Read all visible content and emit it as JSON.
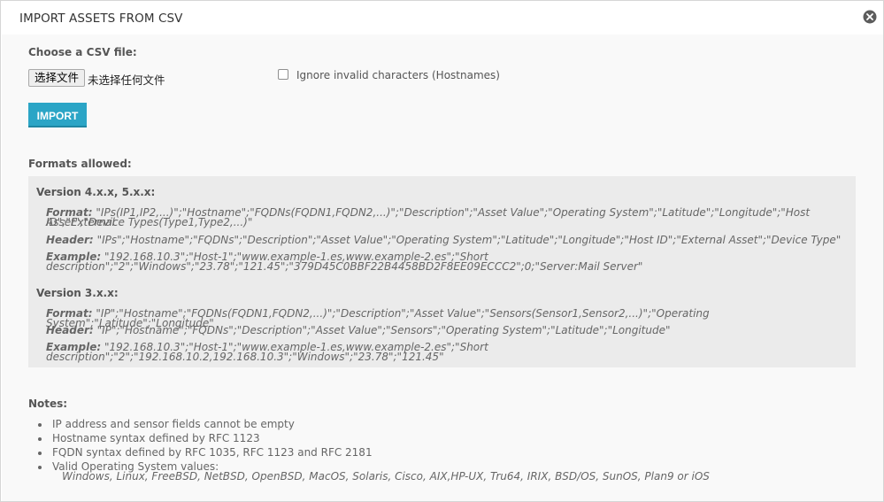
{
  "dialog": {
    "title": "IMPORT ASSETS FROM CSV",
    "choose_label": "Choose a CSV file:",
    "file_button": "选择文件",
    "file_status": "未选择任何文件",
    "ignore_label": "Ignore invalid characters (Hostnames)",
    "import_button": "IMPORT",
    "close_icon": "close-circle-icon"
  },
  "formats": {
    "label": "Formats allowed:",
    "v4": {
      "heading": "Version 4.x.x, 5.x.x:",
      "format_key": "Format:",
      "format_value_1": "\"IPs(IP1,IP2,...)\";\"Hostname\";\"FQDNs(FQDN1,FQDN2,...)\";\"Description\";\"Asset Value\";\"Operating System\";\"Latitude\";\"Longitude\";\"Host ID\";\"External",
      "format_value_2": "Asset\";\"Device Types(Type1,Type2,...)\"",
      "header_key": "Header:",
      "header_value": "\"IPs\";\"Hostname\";\"FQDNs\";\"Description\";\"Asset Value\";\"Operating System\";\"Latitude\";\"Longitude\";\"Host ID\";\"External Asset\";\"Device Type\"",
      "example_key": "Example:",
      "example_value_1": "\"192.168.10.3\";\"Host-1\";\"www.example-1.es,www.example-2.es\";\"Short",
      "example_value_2": "description\";\"2\";\"Windows\";\"23.78\";\"121.45\";\"379D45C0BBF22B4458BD2F8EE09ECCC2\";0;\"Server:Mail Server\""
    },
    "v3": {
      "heading": "Version 3.x.x:",
      "format_key": "Format:",
      "format_value": "\"IP\";\"Hostname\";\"FQDNs(FQDN1,FQDN2,...)\";\"Description\";\"Asset Value\";\"Sensors(Sensor1,Sensor2,...)\";\"Operating System\";\"Latitude\";\"Longitude\"",
      "header_key": "Header:",
      "header_value": "\"IP\";\"Hostname\";\"FQDNs\";\"Description\";\"Asset Value\";\"Sensors\";\"Operating System\";\"Latitude\";\"Longitude\"",
      "example_key": "Example:",
      "example_value": "\"192.168.10.3\";\"Host-1\";\"www.example-1.es,www.example-2.es\";\"Short description\";\"2\";\"192.168.10.2,192.168.10.3\";\"Windows\";\"23.78\";\"121.45\""
    }
  },
  "notes": {
    "label": "Notes:",
    "items": [
      "IP address and sensor fields cannot be empty",
      "Hostname syntax defined by RFC 1123",
      "FQDN syntax defined by RFC 1035, RFC 1123 and RFC 2181",
      "Valid Operating System values:"
    ],
    "os_values": "Windows, Linux, FreeBSD, NetBSD, OpenBSD, MacOS, Solaris, Cisco, AIX,HP-UX, Tru64, IRIX, BSD/OS, SunOS, Plan9 or iOS"
  },
  "colors": {
    "accent": "#2ba5c6",
    "panel": "#ebebeb",
    "background": "#f9f9f9"
  }
}
